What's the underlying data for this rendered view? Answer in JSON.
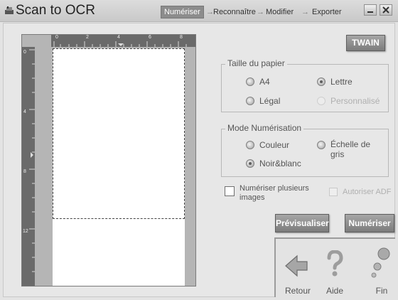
{
  "window": {
    "title": "Scan to OCR"
  },
  "steps": [
    {
      "label": "Numériser"
    },
    {
      "label": "Reconnaître"
    },
    {
      "label": "Modifier"
    },
    {
      "label": "Exporter"
    }
  ],
  "twain_label": "TWAIN",
  "ruler": {
    "top_ticks": [
      "0",
      "2",
      "4",
      "6",
      "8"
    ],
    "left_ticks": [
      "0",
      "4",
      "8",
      "12"
    ]
  },
  "paper_size": {
    "legend": "Taille du papier",
    "options": [
      {
        "label": "A4",
        "selected": false,
        "enabled": true
      },
      {
        "label": "Lettre",
        "selected": true,
        "enabled": true
      },
      {
        "label": "Légal",
        "selected": false,
        "enabled": true
      },
      {
        "label": "Personnalisé",
        "selected": false,
        "enabled": false
      }
    ]
  },
  "scan_mode": {
    "legend": "Mode Numérisation",
    "options": [
      {
        "label": "Couleur",
        "selected": false
      },
      {
        "label": "Échelle de gris",
        "selected": false
      },
      {
        "label": "Noir&blanc",
        "selected": true
      }
    ]
  },
  "multi_scan": {
    "label": "Numériser plusieurs images",
    "checked": false
  },
  "adf": {
    "label": "Autoriser ADF",
    "checked": false,
    "enabled": false
  },
  "buttons": {
    "preview": "Prévisualiser",
    "scan": "Numériser"
  },
  "nav": {
    "back": "Retour",
    "help": "Aide",
    "finish": "Fin"
  },
  "colors": {
    "active_step": "#8c8c8c",
    "dark_button": "#8a8a8a",
    "background": "#e7e7e7"
  }
}
